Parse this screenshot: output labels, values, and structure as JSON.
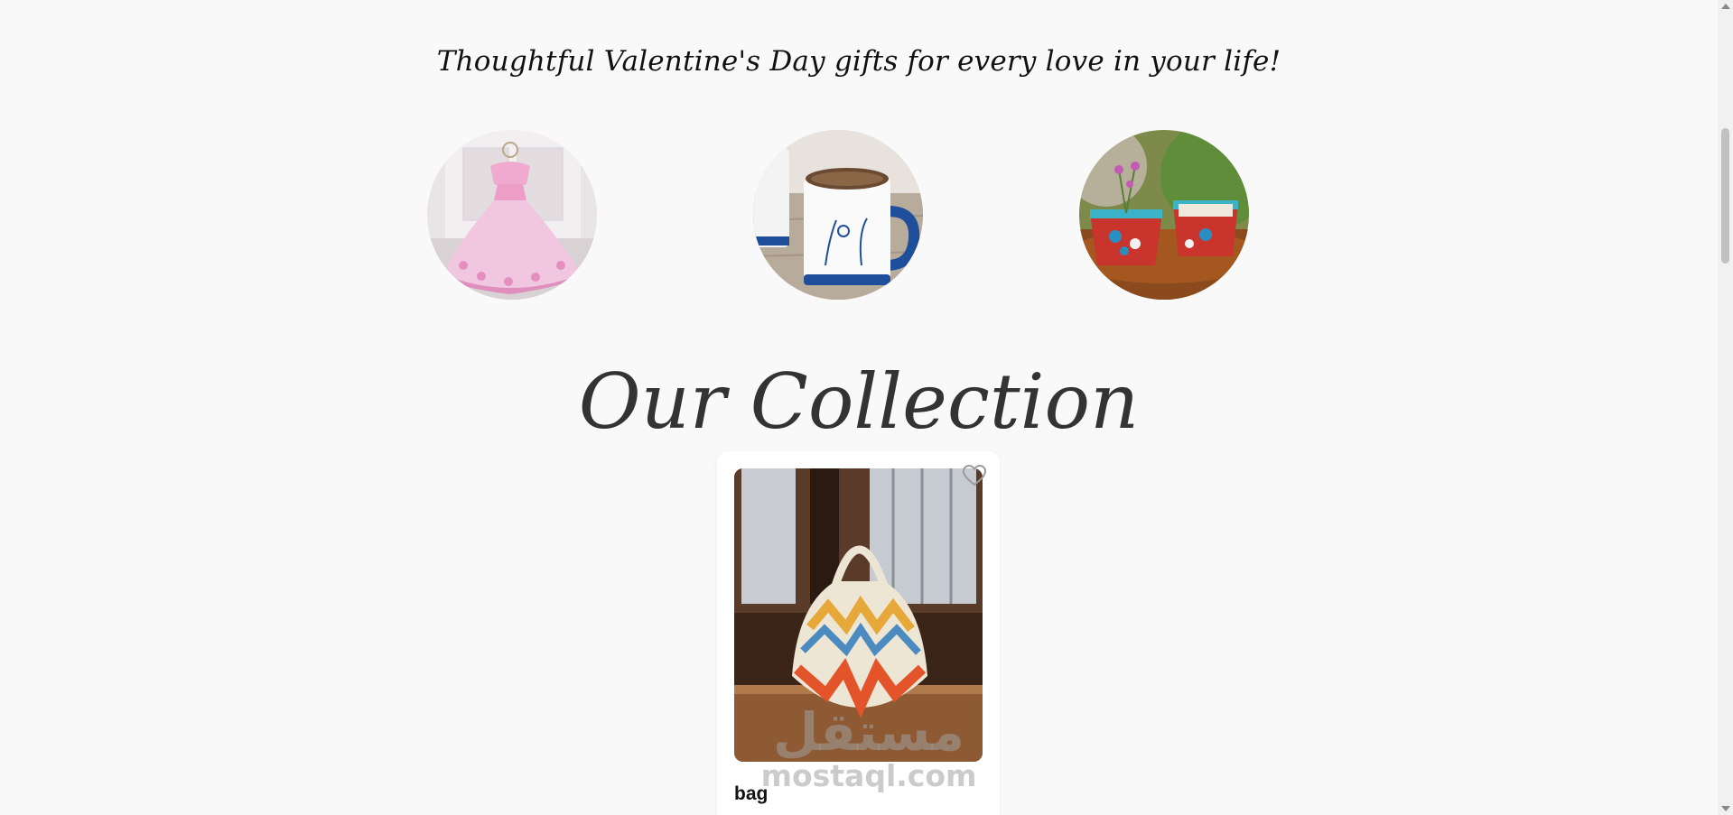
{
  "tagline": "Thoughtful Valentine's Day gifts for every love in your life!",
  "gift_circles": [
    {
      "icon": "pink-dress-image"
    },
    {
      "icon": "blue-white-mug-image"
    },
    {
      "icon": "red-flower-pots-image"
    }
  ],
  "collection": {
    "title": "Our Collection",
    "products": [
      {
        "name": "bag",
        "icon": "crochet-bag-image",
        "favorite_icon": "heart-icon"
      }
    ]
  },
  "watermark": {
    "arabic": "مستقل",
    "latin": "mostaql.com"
  },
  "colors": {
    "background": "#f9f9f9",
    "title_text": "#333333",
    "card_background": "#ffffff"
  }
}
